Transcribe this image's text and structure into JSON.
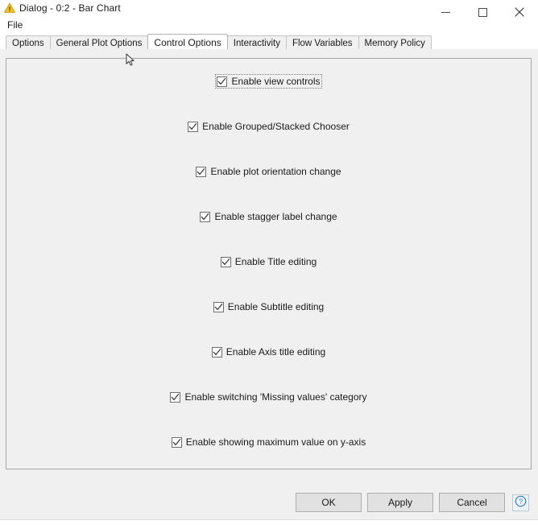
{
  "window": {
    "title": "Dialog - 0:2 - Bar Chart",
    "icon": "warning-triangle-icon",
    "controls": {
      "minimize": "minimize-icon",
      "maximize": "maximize-icon",
      "close": "close-icon"
    }
  },
  "menubar": {
    "items": [
      {
        "label": "File"
      }
    ]
  },
  "tabs": [
    {
      "label": "Options",
      "selected": false
    },
    {
      "label": "General Plot Options",
      "selected": false
    },
    {
      "label": "Control Options",
      "selected": true
    },
    {
      "label": "Interactivity",
      "selected": false
    },
    {
      "label": "Flow Variables",
      "selected": false
    },
    {
      "label": "Memory Policy",
      "selected": false
    }
  ],
  "control_options": {
    "items": [
      {
        "label": "Enable view controls",
        "checked": true,
        "focused": true
      },
      {
        "label": "Enable Grouped/Stacked Chooser",
        "checked": true,
        "focused": false
      },
      {
        "label": "Enable plot orientation change",
        "checked": true,
        "focused": false
      },
      {
        "label": "Enable stagger label change",
        "checked": true,
        "focused": false
      },
      {
        "label": "Enable Title editing",
        "checked": true,
        "focused": false
      },
      {
        "label": "Enable Subtitle editing",
        "checked": true,
        "focused": false
      },
      {
        "label": "Enable Axis title editing",
        "checked": true,
        "focused": false
      },
      {
        "label": "Enable switching 'Missing values' category",
        "checked": true,
        "focused": false
      },
      {
        "label": "Enable showing maximum value on y-axis",
        "checked": true,
        "focused": false
      }
    ]
  },
  "buttons": {
    "ok": "OK",
    "apply": "Apply",
    "cancel": "Cancel",
    "help_icon": "help-question-icon"
  },
  "colors": {
    "dialog_bg": "#f0f0f0",
    "titlebar_bg": "#ffffff",
    "panel_border": "#a8a8a8",
    "help_blue": "#2a7fc9",
    "icon_yellow": "#f2c12e"
  }
}
